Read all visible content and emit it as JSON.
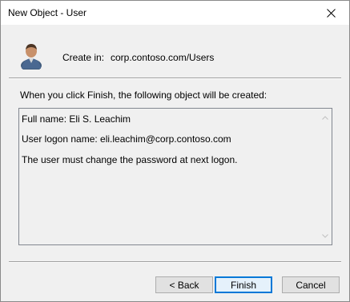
{
  "window": {
    "title": "New Object - User"
  },
  "header": {
    "create_in_label": "Create in:",
    "create_in_value": "corp.contoso.com/Users",
    "icon": "user-icon"
  },
  "intro_text": "When you click Finish, the following object will be created:",
  "summary": {
    "lines": [
      "Full name: Eli S. Leachim",
      "User logon name: eli.leachim@corp.contoso.com",
      "The user must change the password at next logon."
    ]
  },
  "buttons": {
    "back": "< Back",
    "finish": "Finish",
    "cancel": "Cancel"
  },
  "colors": {
    "dialog_background": "#f0f0f0",
    "titlebar_background": "#ffffff",
    "default_button_border": "#0078d7"
  }
}
